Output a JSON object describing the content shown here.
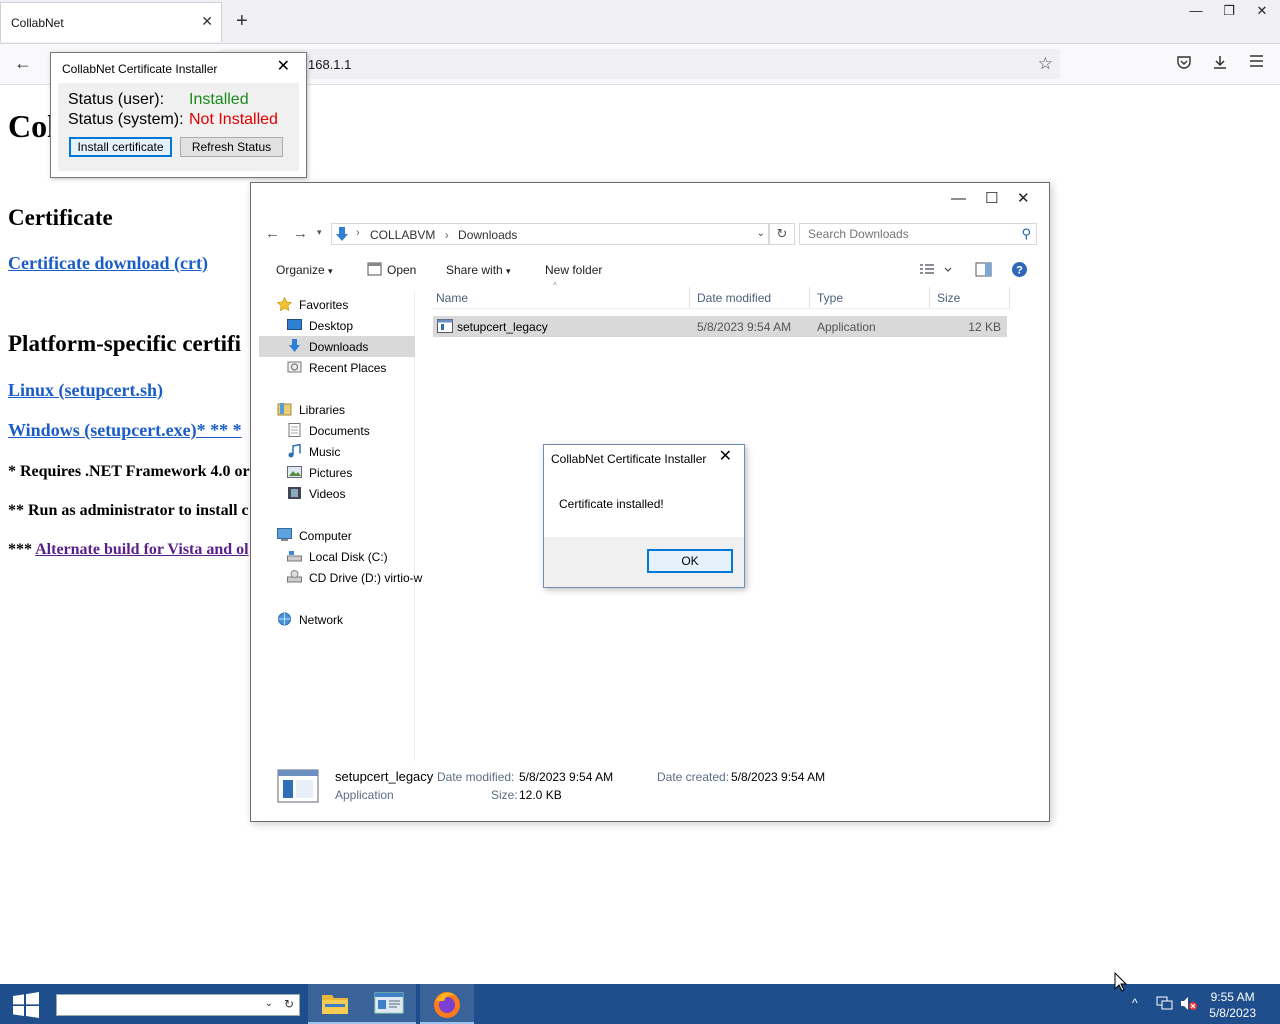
{
  "browser": {
    "tab_title": "CollabNet",
    "tab_close": "✕",
    "new_tab": "+",
    "url": "168.1.1",
    "window_controls": {
      "minimize": "—",
      "restore": "❐",
      "close": "✕"
    }
  },
  "page": {
    "title": "Col",
    "certificate_heading": "Certificate",
    "certificate_link": "Certificate download (crt)",
    "platform_heading": "Platform-specific certifi",
    "linux_link": "Linux (setupcert.sh)",
    "windows_link": "Windows (setupcert.exe)* ** *",
    "note1": "* Requires .NET Framework 4.0 or",
    "note2": "** Run as administrator to install c",
    "note3_prefix": "*** ",
    "note3_link": "Alternate build for Vista and ol"
  },
  "installer": {
    "title": "CollabNet Certificate Installer",
    "close": "✕",
    "status_user_label": "Status (user):",
    "status_user_value": "Installed",
    "status_system_label": "Status (system):",
    "status_system_value": "Not Installed",
    "install_button": "Install certificate",
    "refresh_button": "Refresh Status",
    "colors": {
      "installed": "#1a8a1a",
      "not_installed": "#e00000"
    }
  },
  "explorer": {
    "caption": {
      "minimize": "—",
      "maximize": "☐",
      "close": "✕"
    },
    "breadcrumb": [
      "COLLABVM",
      "Downloads"
    ],
    "search_placeholder": "Search Downloads",
    "refresh": "↻",
    "commands": {
      "organize": "Organize",
      "open": "Open",
      "share_with": "Share with",
      "new_folder": "New folder"
    },
    "nav": {
      "favorites": "Favorites",
      "desktop": "Desktop",
      "downloads": "Downloads",
      "recent_places": "Recent Places",
      "libraries": "Libraries",
      "documents": "Documents",
      "music": "Music",
      "pictures": "Pictures",
      "videos": "Videos",
      "computer": "Computer",
      "local_disk": "Local Disk (C:)",
      "cd_drive": "CD Drive (D:) virtio-w",
      "network": "Network"
    },
    "columns": {
      "name": "Name",
      "date_modified": "Date modified",
      "type": "Type",
      "size": "Size"
    },
    "files": [
      {
        "name": "setupcert_legacy",
        "date_modified": "5/8/2023 9:54 AM",
        "type": "Application",
        "size": "12 KB"
      }
    ],
    "details": {
      "name": "setupcert_legacy",
      "type": "Application",
      "date_modified_label": "Date modified:",
      "date_modified": "5/8/2023 9:54 AM",
      "size_label": "Size:",
      "size": "12.0 KB",
      "date_created_label": "Date created:",
      "date_created": "5/8/2023 9:54 AM"
    }
  },
  "msgbox": {
    "title": "CollabNet Certificate Installer",
    "close": "✕",
    "message": "Certificate installed!",
    "ok": "OK"
  },
  "taskbar": {
    "time": "9:55 AM",
    "date": "5/8/2023",
    "accent": "#1f4e8c"
  }
}
